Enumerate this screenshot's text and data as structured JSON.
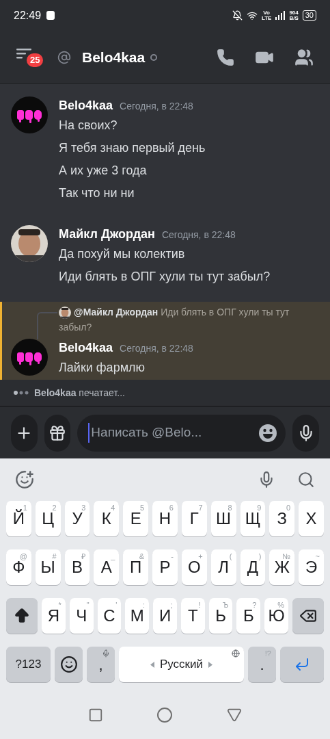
{
  "status_bar": {
    "time": "22:49",
    "network": {
      "top": "Vo",
      "bottom": "LTE"
    },
    "speed": {
      "value": "904",
      "unit": "B/S"
    },
    "battery": "30"
  },
  "header": {
    "badge": "25",
    "title": "Belo4kaa"
  },
  "messages": [
    {
      "author": "Belo4kaa",
      "time": "Сегодня, в 22:48",
      "avatar": {
        "kind": "logo"
      },
      "highlighted": false,
      "lines": [
        "На своих?",
        "Я тебя знаю первый день",
        "А их уже 3 года",
        "Так что ни ни"
      ]
    },
    {
      "author": "Майкл Джордан",
      "time": "Сегодня, в 22:48",
      "avatar": {
        "kind": "person"
      },
      "highlighted": false,
      "lines": [
        "Да похуй мы колектив",
        "Иди блять в ОПГ хули ты тут забыл?"
      ]
    },
    {
      "author": "Belo4kaa",
      "time": "Сегодня, в 22:48",
      "avatar": {
        "kind": "logo"
      },
      "highlighted": true,
      "reply": {
        "author": "@Майкл Джордан",
        "avatar": {
          "kind": "person"
        },
        "text": "Иди блять в ОПГ хули ты тут забыл?"
      },
      "lines": [
        "Лайки фармлю"
      ]
    }
  ],
  "typing": "**Belo4kaa** печатает...",
  "composer": {
    "placeholder": "Написать @Belo..."
  },
  "keyboard": {
    "rows": [
      {
        "keys": [
          {
            "kind": "letter",
            "label": "Й",
            "hint": "1"
          },
          {
            "kind": "letter",
            "label": "Ц",
            "hint": "2"
          },
          {
            "kind": "letter",
            "label": "У",
            "hint": "3"
          },
          {
            "kind": "letter",
            "label": "К",
            "hint": "4"
          },
          {
            "kind": "letter",
            "label": "Е",
            "hint": "5"
          },
          {
            "kind": "letter",
            "label": "Н",
            "hint": "6"
          },
          {
            "kind": "letter",
            "label": "Г",
            "hint": "7"
          },
          {
            "kind": "letter",
            "label": "Ш",
            "hint": "8"
          },
          {
            "kind": "letter",
            "label": "Щ",
            "hint": "9"
          },
          {
            "kind": "letter",
            "label": "З",
            "hint": "0"
          },
          {
            "kind": "letter",
            "label": "Х"
          }
        ]
      },
      {
        "keys": [
          {
            "kind": "letter",
            "label": "Ф",
            "hint": "@"
          },
          {
            "kind": "letter",
            "label": "Ы",
            "hint": "#"
          },
          {
            "kind": "letter",
            "label": "В",
            "hint": "₽"
          },
          {
            "kind": "letter",
            "label": "А",
            "hint": "_"
          },
          {
            "kind": "letter",
            "label": "П",
            "hint": "&"
          },
          {
            "kind": "letter",
            "label": "Р",
            "hint": "-"
          },
          {
            "kind": "letter",
            "label": "О",
            "hint": "+"
          },
          {
            "kind": "letter",
            "label": "Л",
            "hint": "("
          },
          {
            "kind": "letter",
            "label": "Д",
            "hint": ")"
          },
          {
            "kind": "letter",
            "label": "Ж",
            "hint": "№"
          },
          {
            "kind": "letter",
            "label": "Э",
            "hint": "~"
          }
        ]
      },
      {
        "keys": [
          {
            "kind": "shift"
          },
          {
            "kind": "letter",
            "label": "Я",
            "hint": "*"
          },
          {
            "kind": "letter",
            "label": "Ч",
            "hint": "\""
          },
          {
            "kind": "letter",
            "label": "С",
            "hint": "'"
          },
          {
            "kind": "letter",
            "label": "М",
            "hint": ":"
          },
          {
            "kind": "letter",
            "label": "И",
            "hint": ";"
          },
          {
            "kind": "letter",
            "label": "Т",
            "hint": "!"
          },
          {
            "kind": "letter",
            "label": "Ь",
            "hint": "Ъ"
          },
          {
            "kind": "letter",
            "label": "Б",
            "hint": "?"
          },
          {
            "kind": "letter",
            "label": "Ю",
            "hint": "%"
          },
          {
            "kind": "backspace"
          }
        ]
      },
      {
        "keys": [
          {
            "kind": "symbols",
            "label": "?123"
          },
          {
            "kind": "emoji"
          },
          {
            "kind": "comma",
            "label": ","
          },
          {
            "kind": "space",
            "label": "Русский"
          },
          {
            "kind": "period",
            "label": ".",
            "hint": "!?"
          },
          {
            "kind": "enter"
          }
        ]
      }
    ]
  }
}
